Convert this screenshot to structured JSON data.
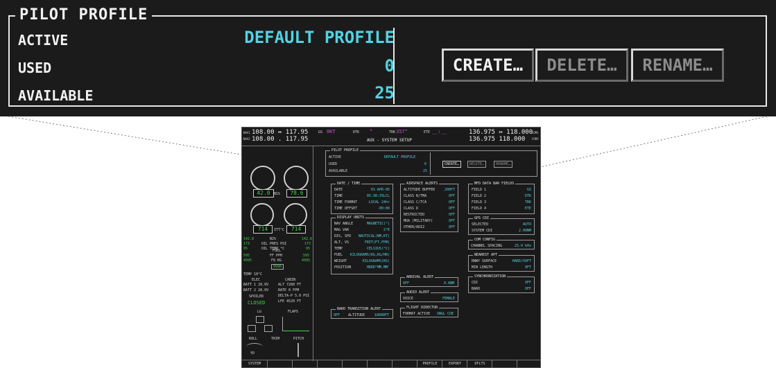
{
  "zoom_panel": {
    "title": "PILOT PROFILE",
    "rows": [
      {
        "label": "ACTIVE",
        "value": "DEFAULT PROFILE"
      },
      {
        "label": "USED",
        "value": "0"
      },
      {
        "label": "AVAILABLE",
        "value": "25"
      }
    ],
    "buttons": {
      "create": "CREATE…",
      "delete": "DELETE…",
      "rename": "RENAME…"
    }
  },
  "mfd": {
    "top_bar": {
      "nav1": "108.00 ↔ 117.95",
      "nav2": "108.00 . 117.95",
      "nav_labels": {
        "nav1": "NAV1",
        "nav2": "NAV2"
      },
      "gs_label": "GS",
      "gs_value": "0KT",
      "dtk_label": "DTK",
      "dtk_value": "°",
      "trk_label": "TRK",
      "trk_value": "357°",
      "ete_label": "ETE",
      "ete_value": "__:__",
      "page_title": "AUX - SYSTEM SETUP",
      "com1": "136.975 ↔ 118.000",
      "com2": "136.975   118.000",
      "com_labels": {
        "com1": "COM1",
        "com2": "COM2"
      }
    },
    "engine": {
      "gauge1": "42.0",
      "gauge2": "78.6",
      "gauge3": "714",
      "gauge4": "714",
      "label_n1": "N1%",
      "label_itt": "ITT°C",
      "rows": [
        {
          "l": "142.8",
          "c": "N2%",
          "r": "142.8"
        },
        {
          "l": "173",
          "c": "OIL PRES PSI",
          "r": "173"
        },
        {
          "l": "95",
          "c": "OIL TEMP °C",
          "r": "95"
        },
        {
          "l": "595",
          "c": "FF PPH",
          "r": "595"
        },
        {
          "l": "4995",
          "c": "FQ KG",
          "r": "4995"
        }
      ],
      "fuel_label": "FUEL",
      "fuel_total": "9990",
      "temp": "TEMP  10°C",
      "elec_label": "ELEC",
      "batt1": "BATT 1  28.0V",
      "batt2": "BATT 2  28.0V",
      "cabin_label": "CABIN",
      "alt": "ALT  7280 FT",
      "rate": "RATE  0 FPM",
      "delta_p": "DELTA-P  5.0 PSI",
      "lfe": "LFE  4520 FT",
      "spoiler_label": "SPOILER",
      "spoiler_value": "CLOSED",
      "lg_label": "LG",
      "flaps_label": "FLAPS",
      "roll_label": "ROLL",
      "yd_label": "YD",
      "pitch_label": "PITCH",
      "trim_label": "TRIM"
    },
    "pilot_profile": {
      "title": "PILOT PROFILE",
      "rows": [
        {
          "l": "ACTIVE",
          "r": "DEFAULT PROFILE"
        },
        {
          "l": "USED",
          "r": "0"
        },
        {
          "l": "AVAILABLE",
          "r": "25"
        }
      ],
      "buttons": [
        "CREATE…",
        "DELETE…",
        "RENAME…"
      ]
    },
    "date_time": {
      "title": "DATE / TIME",
      "rows": [
        {
          "l": "DATE",
          "r": "01-APR-05"
        },
        {
          "l": "TIME",
          "r": "05:38:35LCL"
        },
        {
          "l": "TIME FORMAT",
          "r": "LOCAL 24hr"
        },
        {
          "l": "TIME OFFSET",
          "r": "-00:00"
        }
      ]
    },
    "display_units": {
      "title": "DISPLAY UNITS",
      "rows": [
        {
          "l": "NAV ANGLE",
          "r": "MAGNETIC(°)"
        },
        {
          "l": "MAG VAR",
          "r": "2°E"
        },
        {
          "l": "DIS, SPD",
          "r": "NAUTICAL(NM,KT)"
        },
        {
          "l": "ALT, VS",
          "r": "FEET(FT,FPM)"
        },
        {
          "l": "TEMP",
          "r": "CELSIUS(°C)"
        },
        {
          "l": "FUEL",
          "r": "KILOGRAMS(KG,KG/HR)"
        },
        {
          "l": "WEIGHT",
          "r": "KILOGRAMS(KG)"
        },
        {
          "l": "POSITION",
          "r": "HDDD°MM.MM'"
        }
      ]
    },
    "baro_alert": {
      "title": "BARO TRANSITION ALERT",
      "off": "OFF",
      "label": "ALTITUDE",
      "value": "18000FT"
    },
    "airspace_alerts": {
      "title": "AIRSPACE ALERTS",
      "rows": [
        {
          "l": "ALTITUDE BUFFER",
          "r": "200FT"
        },
        {
          "l": "CLASS B/TMA",
          "r": "OFF"
        },
        {
          "l": "CLASS C/TCA",
          "r": "OFF"
        },
        {
          "l": "CLASS D",
          "r": "OFF"
        },
        {
          "l": "RESTRICTED",
          "r": "OFF"
        },
        {
          "l": "MOA (MILITARY)",
          "r": "OFF"
        },
        {
          "l": "OTHER/ADIZ",
          "r": "OFF"
        }
      ]
    },
    "arrival_alert": {
      "title": "ARRIVAL ALERT",
      "off": "OFF",
      "value": "0.0NM"
    },
    "audio_alert": {
      "title": "AUDIO ALERT",
      "label": "VOICE",
      "value": "FEMALE"
    },
    "flight_director": {
      "title": "FLIGHT DIRECTOR",
      "label": "FORMAT ACTIVE",
      "value": "SNGL CUE"
    },
    "mfd_data_bar": {
      "title": "MFD DATA BAR FIELDS",
      "rows": [
        {
          "l": "FIELD 1",
          "r": "GS"
        },
        {
          "l": "FIELD 2",
          "r": "DTK"
        },
        {
          "l": "FIELD 3",
          "r": "TRK"
        },
        {
          "l": "FIELD 4",
          "r": "ETE"
        }
      ]
    },
    "gps_cdi": {
      "title": "GPS CDI",
      "rows": [
        {
          "l": "SELECTED",
          "r": "AUTO"
        },
        {
          "l": "SYSTEM CDI",
          "r": "2.00NM"
        }
      ]
    },
    "com_config": {
      "title": "COM CONFIG",
      "label": "CHANNEL SPACING",
      "value": "25.0 kHz"
    },
    "nearest_apt": {
      "title": "NEAREST APT",
      "rows": [
        {
          "l": "RNWY SURFACE",
          "r": "HARD/SOFT"
        },
        {
          "l": "MIN LENGTH",
          "r": "0FT"
        }
      ]
    },
    "synchronization": {
      "title": "SYNCHRONIZATION",
      "rows": [
        {
          "l": "CDI",
          "r": "OFF"
        },
        {
          "l": "BARO",
          "r": "OFF"
        }
      ]
    },
    "softkeys": [
      "SYSTEM",
      "",
      "",
      "",
      "",
      "",
      "",
      "PROFILE",
      "EXPORT",
      "DFLTS",
      "",
      ""
    ]
  }
}
